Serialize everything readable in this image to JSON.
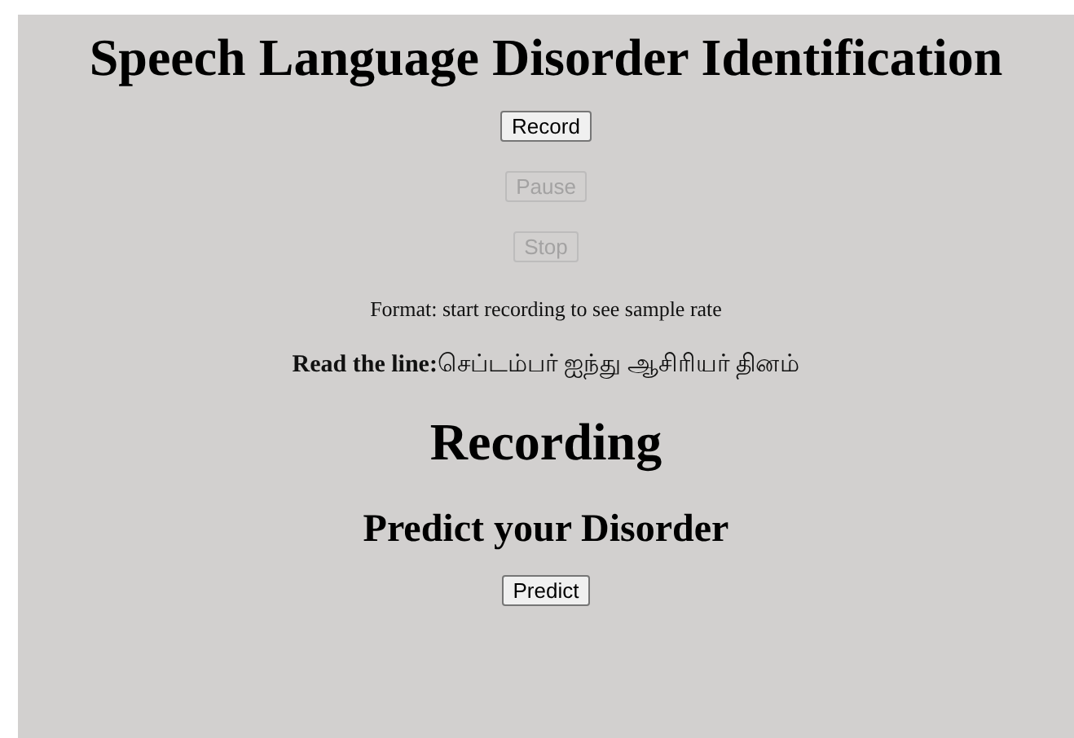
{
  "title": "Speech Language Disorder Identification",
  "controls": [
    {
      "label": "Record",
      "disabled": false
    },
    {
      "label": "Pause",
      "disabled": true
    },
    {
      "label": "Stop",
      "disabled": true
    }
  ],
  "format_text": "Format: start recording to see sample rate",
  "read_line": "**Read the line:**செப்டம்பர் ஐந்து ஆசிரியர் தினம்",
  "recording_heading": "Recording",
  "predict_heading": "Predict your Disorder",
  "predict_button": {
    "label": "Predict",
    "disabled": false
  }
}
